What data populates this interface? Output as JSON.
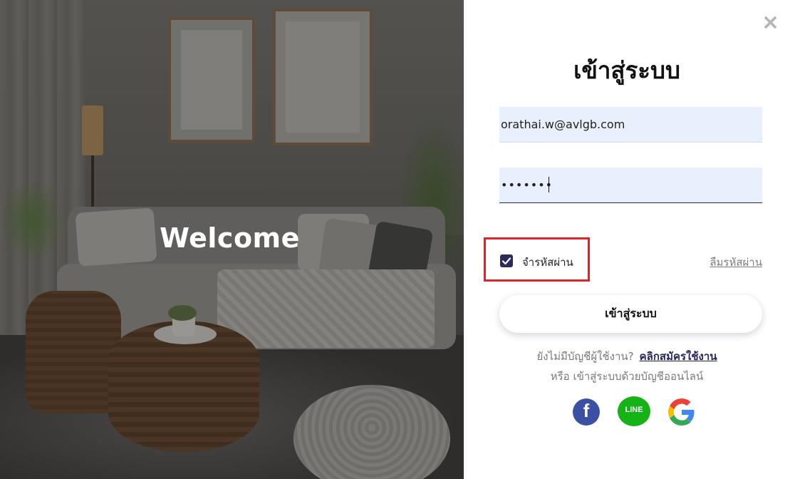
{
  "hero": {
    "welcome_text": "Welcome"
  },
  "login": {
    "close_icon": "close-icon",
    "title": "เข้าสู่ระบบ",
    "email_value": "orathai.w@avlgb.com",
    "password_value": "•••••••",
    "remember_label": "จำรหัสผ่าน",
    "remember_checked": true,
    "forgot_label": "ลืมรหัสผ่าน",
    "submit_label": "เข้าสู่ระบบ",
    "no_account_text": "ยังไม่มีบัญชีผู้ใช้งาน?",
    "signup_link": "คลิกสมัครใช้งาน",
    "social_text": "หรือ เข้าสู่ระบบด้วยบัญชีออนไลน์",
    "social": {
      "facebook_glyph": "f",
      "line_text": "LINE",
      "google_icon": "google-icon"
    }
  },
  "colors": {
    "highlight_box": "#e0222b",
    "checkbox": "#2c2a5e",
    "signup_link": "#272560",
    "facebook": "#3b4fa3",
    "line": "#15b316",
    "input_bg": "#e8f0fe"
  }
}
